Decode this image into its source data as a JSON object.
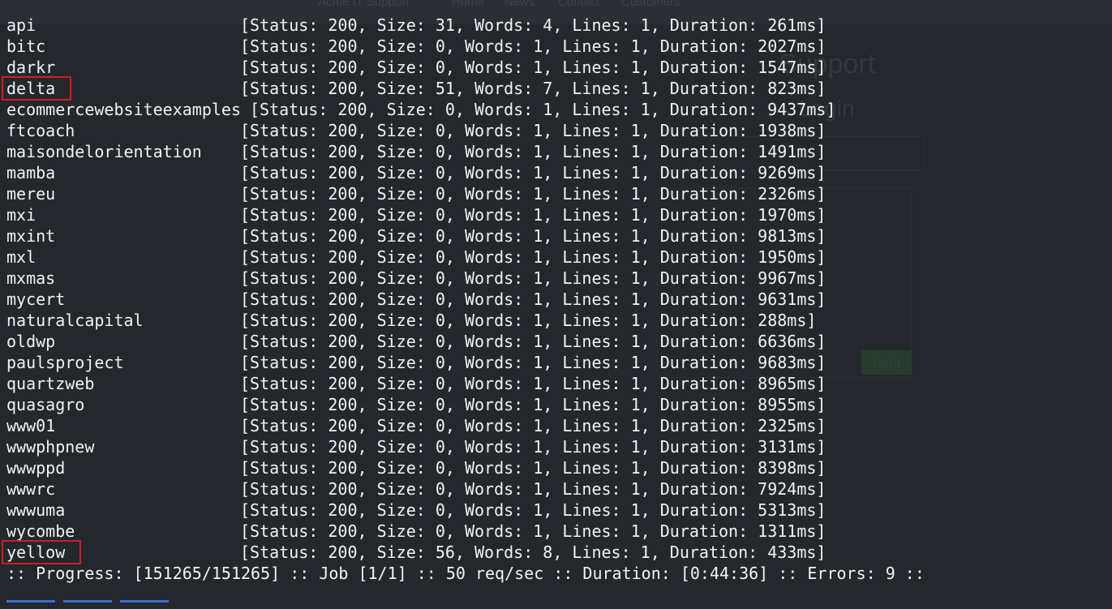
{
  "background_page": {
    "nav_items": [
      "Acme IT Support",
      "Home",
      "News",
      "Contact",
      "Customers"
    ],
    "heading_1": "Support",
    "heading_2": "Login",
    "button_label": "Login"
  },
  "results": [
    {
      "name": "api",
      "status": 200,
      "size": 31,
      "words": 4,
      "lines": 1,
      "duration": "261ms",
      "text": "[Status: 200, Size: 31, Words: 4, Lines: 1, Duration: 261ms]"
    },
    {
      "name": "bitc",
      "status": 200,
      "size": 0,
      "words": 1,
      "lines": 1,
      "duration": "2027ms",
      "text": "[Status: 200, Size: 0, Words: 1, Lines: 1, Duration: 2027ms]"
    },
    {
      "name": "darkr",
      "status": 200,
      "size": 0,
      "words": 1,
      "lines": 1,
      "duration": "1547ms",
      "text": "[Status: 200, Size: 0, Words: 1, Lines: 1, Duration: 1547ms]"
    },
    {
      "name": "delta",
      "status": 200,
      "size": 51,
      "words": 7,
      "lines": 1,
      "duration": "823ms",
      "text": "[Status: 200, Size: 51, Words: 7, Lines: 1, Duration: 823ms]",
      "highlighted": true
    },
    {
      "name": "ecommercewebsiteexamples",
      "status": 200,
      "size": 0,
      "words": 1,
      "lines": 1,
      "duration": "9437ms",
      "text": "[Status: 200, Size: 0, Words: 1, Lines: 1, Duration: 9437ms]"
    },
    {
      "name": "ftcoach",
      "status": 200,
      "size": 0,
      "words": 1,
      "lines": 1,
      "duration": "1938ms",
      "text": "[Status: 200, Size: 0, Words: 1, Lines: 1, Duration: 1938ms]"
    },
    {
      "name": "maisondelorientation",
      "status": 200,
      "size": 0,
      "words": 1,
      "lines": 1,
      "duration": "1491ms",
      "text": "[Status: 200, Size: 0, Words: 1, Lines: 1, Duration: 1491ms]"
    },
    {
      "name": "mamba",
      "status": 200,
      "size": 0,
      "words": 1,
      "lines": 1,
      "duration": "9269ms",
      "text": "[Status: 200, Size: 0, Words: 1, Lines: 1, Duration: 9269ms]"
    },
    {
      "name": "mereu",
      "status": 200,
      "size": 0,
      "words": 1,
      "lines": 1,
      "duration": "2326ms",
      "text": "[Status: 200, Size: 0, Words: 1, Lines: 1, Duration: 2326ms]"
    },
    {
      "name": "mxi",
      "status": 200,
      "size": 0,
      "words": 1,
      "lines": 1,
      "duration": "1970ms",
      "text": "[Status: 200, Size: 0, Words: 1, Lines: 1, Duration: 1970ms]"
    },
    {
      "name": "mxint",
      "status": 200,
      "size": 0,
      "words": 1,
      "lines": 1,
      "duration": "9813ms",
      "text": "[Status: 200, Size: 0, Words: 1, Lines: 1, Duration: 9813ms]"
    },
    {
      "name": "mxl",
      "status": 200,
      "size": 0,
      "words": 1,
      "lines": 1,
      "duration": "1950ms",
      "text": "[Status: 200, Size: 0, Words: 1, Lines: 1, Duration: 1950ms]"
    },
    {
      "name": "mxmas",
      "status": 200,
      "size": 0,
      "words": 1,
      "lines": 1,
      "duration": "9967ms",
      "text": "[Status: 200, Size: 0, Words: 1, Lines: 1, Duration: 9967ms]"
    },
    {
      "name": "mycert",
      "status": 200,
      "size": 0,
      "words": 1,
      "lines": 1,
      "duration": "9631ms",
      "text": "[Status: 200, Size: 0, Words: 1, Lines: 1, Duration: 9631ms]"
    },
    {
      "name": "naturalcapital",
      "status": 200,
      "size": 0,
      "words": 1,
      "lines": 1,
      "duration": "288ms",
      "text": "[Status: 200, Size: 0, Words: 1, Lines: 1, Duration: 288ms]"
    },
    {
      "name": "oldwp",
      "status": 200,
      "size": 0,
      "words": 1,
      "lines": 1,
      "duration": "6636ms",
      "text": "[Status: 200, Size: 0, Words: 1, Lines: 1, Duration: 6636ms]"
    },
    {
      "name": "paulsproject",
      "status": 200,
      "size": 0,
      "words": 1,
      "lines": 1,
      "duration": "9683ms",
      "text": "[Status: 200, Size: 0, Words: 1, Lines: 1, Duration: 9683ms]"
    },
    {
      "name": "quartzweb",
      "status": 200,
      "size": 0,
      "words": 1,
      "lines": 1,
      "duration": "8965ms",
      "text": "[Status: 200, Size: 0, Words: 1, Lines: 1, Duration: 8965ms]"
    },
    {
      "name": "quasagro",
      "status": 200,
      "size": 0,
      "words": 1,
      "lines": 1,
      "duration": "8955ms",
      "text": "[Status: 200, Size: 0, Words: 1, Lines: 1, Duration: 8955ms]"
    },
    {
      "name": "www01",
      "status": 200,
      "size": 0,
      "words": 1,
      "lines": 1,
      "duration": "2325ms",
      "text": "[Status: 200, Size: 0, Words: 1, Lines: 1, Duration: 2325ms]"
    },
    {
      "name": "wwwphpnew",
      "status": 200,
      "size": 0,
      "words": 1,
      "lines": 1,
      "duration": "3131ms",
      "text": "[Status: 200, Size: 0, Words: 1, Lines: 1, Duration: 3131ms]"
    },
    {
      "name": "wwwppd",
      "status": 200,
      "size": 0,
      "words": 1,
      "lines": 1,
      "duration": "8398ms",
      "text": "[Status: 200, Size: 0, Words: 1, Lines: 1, Duration: 8398ms]"
    },
    {
      "name": "wwwrc",
      "status": 200,
      "size": 0,
      "words": 1,
      "lines": 1,
      "duration": "7924ms",
      "text": "[Status: 200, Size: 0, Words: 1, Lines: 1, Duration: 7924ms]"
    },
    {
      "name": "wwwuma",
      "status": 200,
      "size": 0,
      "words": 1,
      "lines": 1,
      "duration": "5313ms",
      "text": "[Status: 200, Size: 0, Words: 1, Lines: 1, Duration: 5313ms]"
    },
    {
      "name": "wycombe",
      "status": 200,
      "size": 0,
      "words": 1,
      "lines": 1,
      "duration": "1311ms",
      "text": "[Status: 200, Size: 0, Words: 1, Lines: 1, Duration: 1311ms]"
    },
    {
      "name": "yellow",
      "status": 200,
      "size": 56,
      "words": 8,
      "lines": 1,
      "duration": "433ms",
      "text": "[Status: 200, Size: 56, Words: 8, Lines: 1, Duration: 433ms]",
      "highlighted": true
    }
  ],
  "progress_line": ":: Progress: [151265/151265] :: Job [1/1] :: 50 req/sec :: Duration: [0:44:36] :: Errors: 9 ::",
  "colors": {
    "terminal_text": "#f2f2f2",
    "terminal_bg": "#1f2227",
    "highlight_border": "#d11e1e",
    "prompt_accent": "#3a6fd8"
  }
}
